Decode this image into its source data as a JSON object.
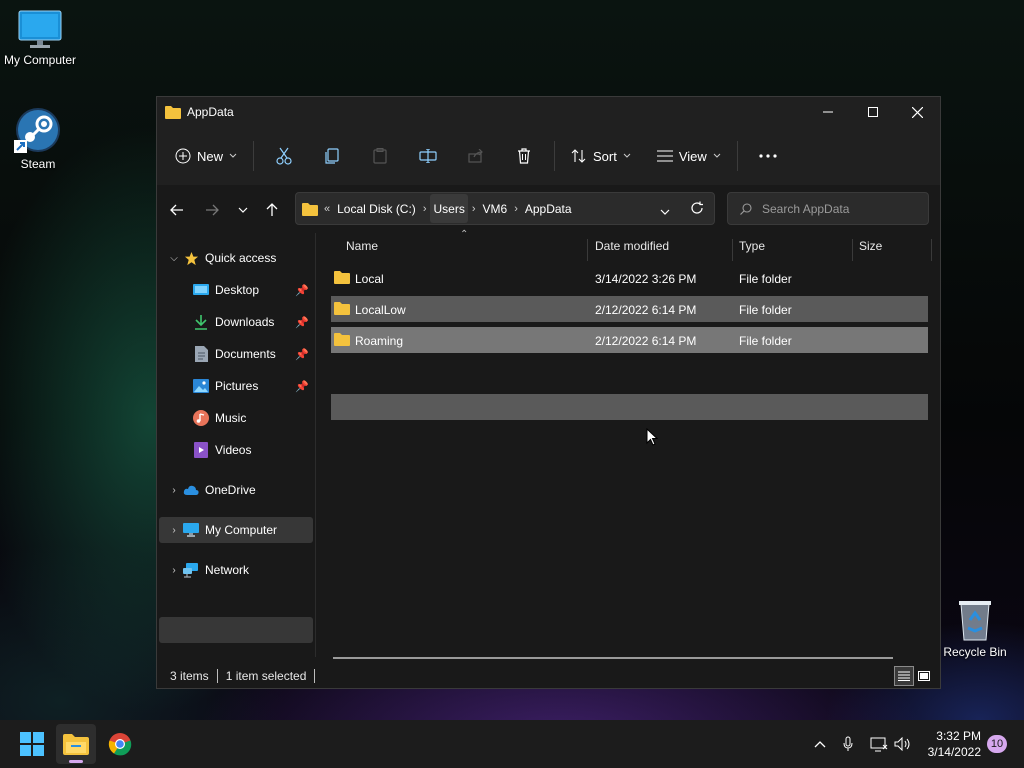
{
  "desktop": {
    "icons": [
      {
        "label": "My Computer",
        "icon": "monitor-icon"
      },
      {
        "label": "Steam",
        "icon": "steam-icon"
      },
      {
        "label": "Recycle Bin",
        "icon": "recycle-bin-icon"
      }
    ]
  },
  "window": {
    "title": "AppData",
    "toolbar": {
      "new_label": "New",
      "sort_label": "Sort",
      "view_label": "View"
    },
    "address": {
      "overflow": "«",
      "segments": [
        "Local Disk (C:)",
        "Users",
        "VM6",
        "AppData"
      ]
    },
    "search": {
      "placeholder": "Search AppData"
    },
    "sidebar": {
      "quick_access": "Quick access",
      "items": [
        {
          "label": "Desktop",
          "icon": "desktop-icon",
          "pinned": true
        },
        {
          "label": "Downloads",
          "icon": "download-icon",
          "pinned": true
        },
        {
          "label": "Documents",
          "icon": "document-icon",
          "pinned": true
        },
        {
          "label": "Pictures",
          "icon": "pictures-icon",
          "pinned": true
        },
        {
          "label": "Music",
          "icon": "music-icon",
          "pinned": false
        },
        {
          "label": "Videos",
          "icon": "video-icon",
          "pinned": false
        }
      ],
      "onedrive": "OneDrive",
      "my_computer": "My Computer",
      "network": "Network"
    },
    "columns": {
      "name": "Name",
      "date": "Date modified",
      "type": "Type",
      "size": "Size"
    },
    "files": [
      {
        "name": "Local",
        "date": "3/14/2022 3:26 PM",
        "type": "File folder",
        "size": ""
      },
      {
        "name": "LocalLow",
        "date": "2/12/2022 6:14 PM",
        "type": "File folder",
        "size": ""
      },
      {
        "name": "Roaming",
        "date": "2/12/2022 6:14 PM",
        "type": "File folder",
        "size": ""
      }
    ],
    "status": {
      "count": "3 items",
      "selected": "1 item selected"
    }
  },
  "taskbar": {
    "time": "3:32 PM",
    "date": "3/14/2022",
    "notifications": "10"
  },
  "colors": {
    "folder": "#f4c23d",
    "accent": "#4cc2ff",
    "selection": "#777777"
  }
}
